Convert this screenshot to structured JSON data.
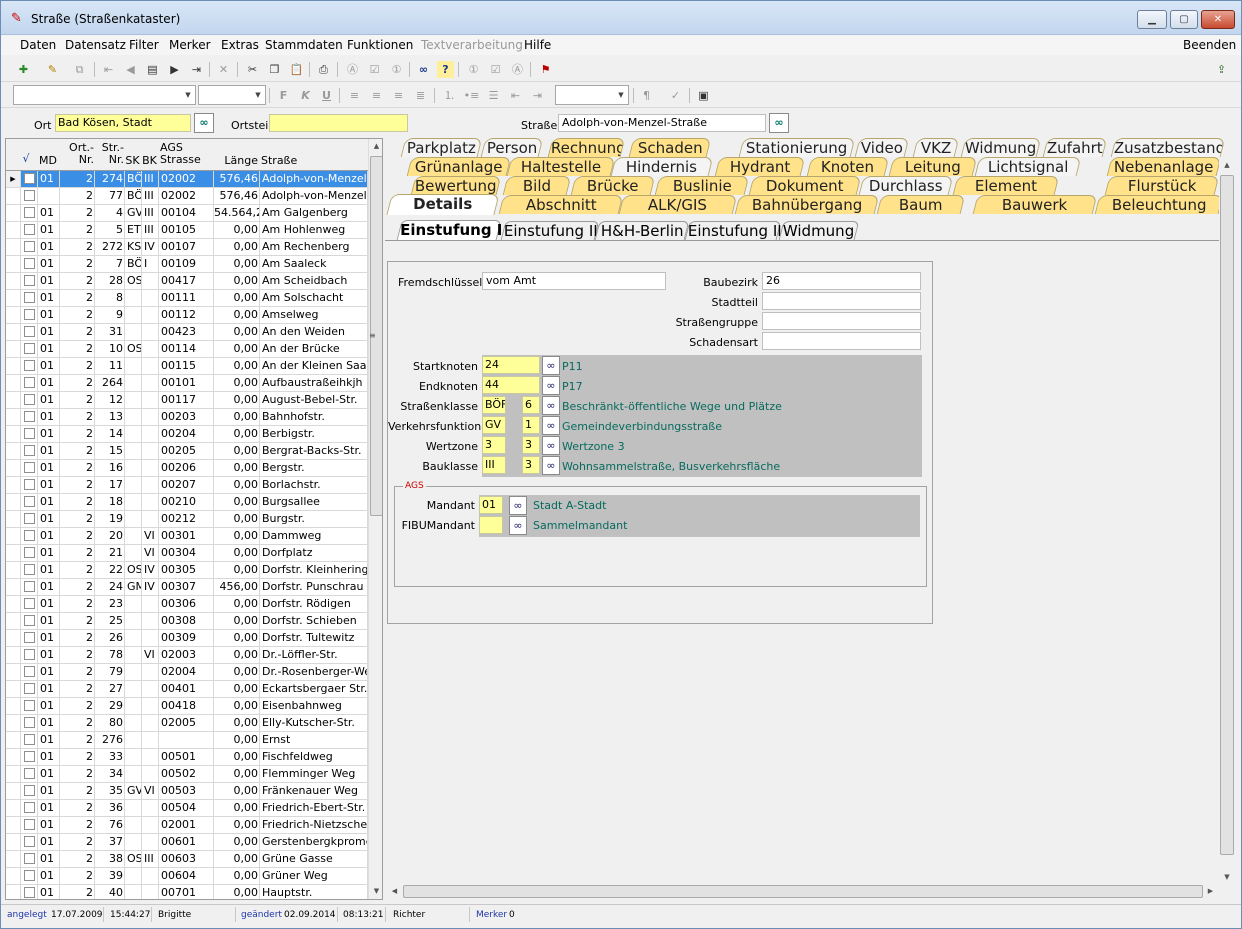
{
  "window": {
    "title": "Straße (Straßenkataster)",
    "icon": "road-app-icon"
  },
  "menu": {
    "items": [
      "Daten",
      "Datensatz",
      "Filter",
      "Merker",
      "Extras",
      "Stammdaten",
      "Funktionen",
      "Textverarbeitung",
      "Hilfe"
    ],
    "right": "Beenden"
  },
  "filter": {
    "ort_label": "Ort",
    "ort_value": "Bad Kösen, Stadt",
    "ortsteil_label": "Ortsteil",
    "ortsteil_value": "",
    "strasse_label": "Straße",
    "strasse_value": "Adolph-von-Menzel-Straße"
  },
  "grid": {
    "headers": {
      "check": "√",
      "md": "MD",
      "ort": "Ort.-\nNr.",
      "str": "Str.-\nNr.",
      "sk": "SK",
      "bk": "BK",
      "ags": "AGS\nStrasse",
      "laenge": "Länge",
      "strasse": "Straße"
    },
    "rows": [
      [
        "01",
        "2",
        "274",
        "BÖ",
        "III",
        "02002",
        "576,46",
        "Adolph-von-Menzel-St"
      ],
      [
        "",
        "2",
        "77",
        "BÖ",
        "III",
        "02002",
        "576,46",
        "Adolph-von-Menzel-St"
      ],
      [
        "01",
        "2",
        "4",
        "GV",
        "III",
        "00104",
        "54.564,23",
        "Am Galgenberg"
      ],
      [
        "01",
        "2",
        "5",
        "ET",
        "III",
        "00105",
        "0,00",
        "Am Hohlenweg"
      ],
      [
        "01",
        "2",
        "272",
        "KS",
        "IV",
        "00107",
        "0,00",
        "Am Rechenberg"
      ],
      [
        "01",
        "2",
        "7",
        "BÖ",
        "I",
        "00109",
        "0,00",
        "Am Saaleck"
      ],
      [
        "01",
        "2",
        "28",
        "OS",
        "",
        "00417",
        "0,00",
        "Am Scheidbach"
      ],
      [
        "01",
        "2",
        "8",
        "",
        "",
        "00111",
        "0,00",
        "Am Solschacht"
      ],
      [
        "01",
        "2",
        "9",
        "",
        "",
        "00112",
        "0,00",
        "Amselweg"
      ],
      [
        "01",
        "2",
        "31",
        "",
        "",
        "00423",
        "0,00",
        "An den Weiden"
      ],
      [
        "01",
        "2",
        "10",
        "OS",
        "",
        "00114",
        "0,00",
        "An der Brücke"
      ],
      [
        "01",
        "2",
        "11",
        "",
        "",
        "00115",
        "0,00",
        "An der Kleinen Saale"
      ],
      [
        "01",
        "2",
        "264",
        "",
        "",
        "00101",
        "0,00",
        "Aufbaustraßeihkjh"
      ],
      [
        "01",
        "2",
        "12",
        "",
        "",
        "00117",
        "0,00",
        "August-Bebel-Str."
      ],
      [
        "01",
        "2",
        "13",
        "",
        "",
        "00203",
        "0,00",
        "Bahnhofstr."
      ],
      [
        "01",
        "2",
        "14",
        "",
        "",
        "00204",
        "0,00",
        "Berbigstr."
      ],
      [
        "01",
        "2",
        "15",
        "",
        "",
        "00205",
        "0,00",
        "Bergrat-Backs-Str."
      ],
      [
        "01",
        "2",
        "16",
        "",
        "",
        "00206",
        "0,00",
        "Bergstr."
      ],
      [
        "01",
        "2",
        "17",
        "",
        "",
        "00207",
        "0,00",
        "Borlachstr."
      ],
      [
        "01",
        "2",
        "18",
        "",
        "",
        "00210",
        "0,00",
        "Burgsallee"
      ],
      [
        "01",
        "2",
        "19",
        "",
        "",
        "00212",
        "0,00",
        "Burgstr."
      ],
      [
        "01",
        "2",
        "20",
        "",
        "VI",
        "00301",
        "0,00",
        "Dammweg"
      ],
      [
        "01",
        "2",
        "21",
        "",
        "VI",
        "00304",
        "0,00",
        "Dorfplatz"
      ],
      [
        "01",
        "2",
        "22",
        "OS",
        "IV",
        "00305",
        "0,00",
        "Dorfstr. Kleinheringen"
      ],
      [
        "01",
        "2",
        "24",
        "GM",
        "IV",
        "00307",
        "456,00",
        "Dorfstr. Punschrau"
      ],
      [
        "01",
        "2",
        "23",
        "",
        "",
        "00306",
        "0,00",
        "Dorfstr. Rödigen"
      ],
      [
        "01",
        "2",
        "25",
        "",
        "",
        "00308",
        "0,00",
        "Dorfstr. Schieben"
      ],
      [
        "01",
        "2",
        "26",
        "",
        "",
        "00309",
        "0,00",
        "Dorfstr. Tultewitz"
      ],
      [
        "01",
        "2",
        "78",
        "",
        "VI",
        "02003",
        "0,00",
        "Dr.-Löffler-Str."
      ],
      [
        "01",
        "2",
        "79",
        "",
        "",
        "02004",
        "0,00",
        "Dr.-Rosenberger-Weg"
      ],
      [
        "01",
        "2",
        "27",
        "",
        "",
        "00401",
        "0,00",
        "Eckartsbergaer Str."
      ],
      [
        "01",
        "2",
        "29",
        "",
        "",
        "00418",
        "0,00",
        "Eisenbahnweg"
      ],
      [
        "01",
        "2",
        "80",
        "",
        "",
        "02005",
        "0,00",
        "Elly-Kutscher-Str."
      ],
      [
        "01",
        "2",
        "276",
        "",
        "",
        "",
        "0,00",
        "Ernst"
      ],
      [
        "01",
        "2",
        "33",
        "",
        "",
        "00501",
        "0,00",
        "Fischfeldweg"
      ],
      [
        "01",
        "2",
        "34",
        "",
        "",
        "00502",
        "0,00",
        "Flemminger Weg"
      ],
      [
        "01",
        "2",
        "35",
        "GV",
        "VI",
        "00503",
        "0,00",
        "Fränkenauer Weg"
      ],
      [
        "01",
        "2",
        "36",
        "",
        "",
        "00504",
        "0,00",
        "Friedrich-Ebert-Str."
      ],
      [
        "01",
        "2",
        "76",
        "",
        "",
        "02001",
        "0,00",
        "Friedrich-Nietzsche-Str"
      ],
      [
        "01",
        "2",
        "37",
        "",
        "",
        "00601",
        "0,00",
        "Gerstenbergkpromena"
      ],
      [
        "01",
        "2",
        "38",
        "OS",
        "III",
        "00603",
        "0,00",
        "Grüne Gasse"
      ],
      [
        "01",
        "2",
        "39",
        "",
        "",
        "00604",
        "0,00",
        "Grüner Weg"
      ],
      [
        "01",
        "2",
        "40",
        "",
        "",
        "00701",
        "0,00",
        "Hauptstr."
      ]
    ]
  },
  "tabs": {
    "row1": [
      "Parkplatz",
      "Person",
      "Rechnung",
      "Schaden",
      "Stationierung",
      "Video",
      "VKZ",
      "Widmung",
      "Zufahrt",
      "Zusatzbestand"
    ],
    "row2": [
      "Grünanlage",
      "Haltestelle",
      "Hindernis",
      "Hydrant",
      "Knoten",
      "Leitung",
      "Lichtsignal",
      "Nebenanlage"
    ],
    "row3": [
      "Bewertung",
      "Bild",
      "Brücke",
      "Buslinie",
      "Dokument",
      "Durchlass",
      "Element",
      "Flurstück"
    ],
    "row4": [
      "Details",
      "Abschnitt",
      "ALK/GIS",
      "Bahnübergang",
      "Baum",
      "Bauwerk",
      "Beleuchtung"
    ],
    "sub": [
      "Einstufung I",
      "Einstufung II",
      "H&H-Berlin",
      "Einstufung II",
      "Widmung"
    ]
  },
  "form": {
    "fremdschluessel_label": "Fremdschlüssel",
    "fremdschluessel": "vom Amt",
    "baubezirk_label": "Baubezirk",
    "baubezirk": "26",
    "stadtteil_label": "Stadtteil",
    "stadtteil": "",
    "strassengruppe_label": "Straßengruppe",
    "strassengruppe": "",
    "schadensart_label": "Schadensart",
    "schadensart": "",
    "startknoten_label": "Startknoten",
    "startknoten": "24",
    "startknoten_desc": "P11",
    "endknoten_label": "Endknoten",
    "endknoten": "44",
    "endknoten_desc": "P17",
    "strassenklasse_label": "Straßenklasse",
    "strassenklasse": "BÖF",
    "strassenklasse_nr": "6",
    "strassenklasse_desc": "Beschränkt-öffentliche Wege und Plätze",
    "verkehrsfunktion_label": "Verkehrsfunktion",
    "verkehrsfunktion": "GV",
    "verkehrsfunktion_nr": "1",
    "verkehrsfunktion_desc": "Gemeindeverbindungsstraße",
    "wertzone_label": "Wertzone",
    "wertzone": "3",
    "wertzone_nr": "3",
    "wertzone_desc": "Wertzone 3",
    "bauklasse_label": "Bauklasse",
    "bauklasse": "III",
    "bauklasse_nr": "3",
    "bauklasse_desc": "Wohnsammelstraße, Busverkehrsfläche",
    "ags_group": "AGS",
    "mandant_label": "Mandant",
    "mandant": "01",
    "mandant_desc": "Stadt A-Stadt",
    "fibumandant_label": "FIBUMandant",
    "fibumandant": "",
    "fibumandant_desc": "Sammelmandant"
  },
  "status": {
    "angelegt_label": "angelegt",
    "angelegt_date": "17.07.2009",
    "angelegt_time": "15:44:27",
    "angelegt_user": "Brigitte",
    "geaendert_label": "geändert",
    "geaendert_date": "02.09.2014",
    "geaendert_time": "08:13:21",
    "geaendert_user": "Richter",
    "merker_label": "Merker",
    "merker_value": "0"
  }
}
